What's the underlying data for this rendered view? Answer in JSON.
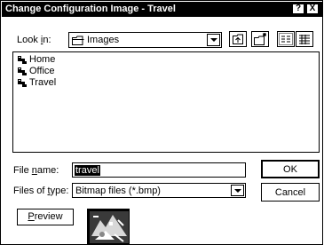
{
  "window": {
    "title": "Change Configuration Image - Travel",
    "help_label": "?",
    "close_label": "X"
  },
  "look_in": {
    "label_prefix": "Look ",
    "label_key": "i",
    "label_suffix": "n:",
    "value": "Images"
  },
  "files": [
    {
      "label": "Home",
      "icon": "folder-network-icon"
    },
    {
      "label": "Office",
      "icon": "folder-network-icon"
    },
    {
      "label": "Travel",
      "icon": "folder-network-icon"
    }
  ],
  "file_name": {
    "label_prefix": "File ",
    "label_key": "n",
    "label_suffix": "ame:",
    "value": "travel"
  },
  "files_of_type": {
    "label_prefix": "Files of ",
    "label_key": "t",
    "label_suffix": "ype:",
    "value": "Bitmap files (*.bmp)"
  },
  "buttons": {
    "ok": "OK",
    "cancel": "Cancel",
    "preview_key": "P",
    "preview_rest": "review"
  },
  "toolbar": [
    "up-folder-icon",
    "new-folder-icon",
    "list-view-icon",
    "details-view-icon"
  ]
}
